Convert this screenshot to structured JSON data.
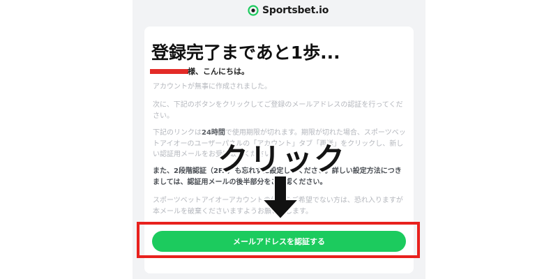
{
  "header": {
    "brand_name": "Sportsbet.io",
    "brand_icon": "sportsbet-logo-icon"
  },
  "email": {
    "title": "登録完了まであと1歩...",
    "greeting_suffix": "様、こんにちは。",
    "paragraphs": [
      "アカウントが無事に作成されました。",
      "次に、下記のボタンをクリックしてご登録のメールアドレスの認証を行ってください。"
    ],
    "link_notice": {
      "before": "下記のリンクは",
      "highlight": "24時間",
      "after": "で使用期限が切れます。期限が切れた場合、スポーツベットアイオーのユーザーパネルの「アカウント」タブ「再送」をクリックし、新しい認証用メールをお受け取りください。"
    },
    "twofa_notice": "また、2段階認証（2FA）も忘れずに設定してください。詳しい設定方法につきましては、認証用メールの後半部分をご確認ください。",
    "disclaimer": "スポーツベットアイオーアカウントの作成をご希望でない方は、恐れ入りますが本メールを破棄くださいますようお願い致します。",
    "verify_button_label": "メールアドレスを認証する"
  },
  "annotation": {
    "click_label": "クリック",
    "arrow_icon": "down-arrow-icon",
    "colors": {
      "highlight": "#e8211d",
      "redaction": "#e32b27"
    }
  },
  "colors": {
    "button_green": "#1ccb5e",
    "brand_green": "#1ccb5e",
    "page_background": "#f2f3f5",
    "card_background": "#ffffff"
  }
}
